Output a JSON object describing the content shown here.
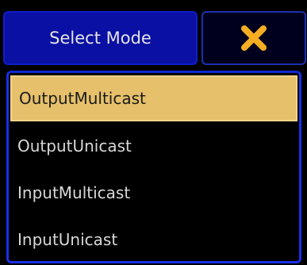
{
  "header": {
    "title": "Select Mode",
    "close_icon": "close-x-icon"
  },
  "colors": {
    "title_bg": "#0a10a3",
    "close_icon": "#f5ae22",
    "selected_bg": "#e6c06a",
    "list_border": "#1a2fe8"
  },
  "modes": [
    {
      "label": "OutputMulticast",
      "selected": true
    },
    {
      "label": "OutputUnicast",
      "selected": false
    },
    {
      "label": "InputMulticast",
      "selected": false
    },
    {
      "label": "InputUnicast",
      "selected": false
    }
  ]
}
